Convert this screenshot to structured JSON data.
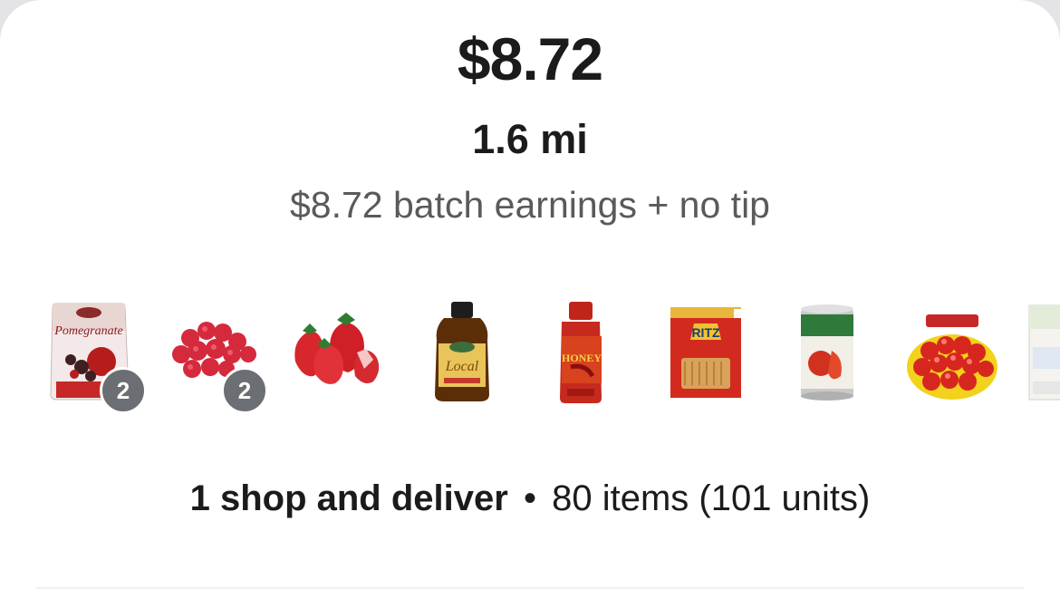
{
  "offer": {
    "price": "$8.72",
    "distance": "1.6 mi",
    "earnings_line": "$8.72 batch earnings + no tip"
  },
  "items": [
    {
      "name": "Dark Chocolate Pomegranate",
      "icon": "pomegranate-chocolate-bag-icon",
      "brand_text": "Pomegranate",
      "quantity": "2"
    },
    {
      "name": "Raspberries",
      "icon": "raspberries-icon",
      "quantity": "2"
    },
    {
      "name": "Strawberries",
      "icon": "strawberries-icon"
    },
    {
      "name": "Local Honey",
      "icon": "honey-bottle-icon",
      "label_text": "Local"
    },
    {
      "name": "Hot Honey",
      "icon": "hot-honey-bottle-icon",
      "label_text": "HONEY"
    },
    {
      "name": "Ritz Fresh Stacks",
      "icon": "ritz-crackers-box-icon",
      "label_text": "RITZ"
    },
    {
      "name": "Canned Tomatoes",
      "icon": "canned-tomatoes-icon"
    },
    {
      "name": "Cherubs Tomatoes",
      "icon": "cherry-tomatoes-icon"
    },
    {
      "name": "Simply Nature",
      "icon": "simply-nature-package-icon"
    }
  ],
  "summary": {
    "type": "1 shop and deliver",
    "separator": "•",
    "counts": "80 items (101 units)"
  },
  "colors": {
    "text_primary": "#1b1b1b",
    "text_secondary": "#5a5a5a",
    "badge": "#6b6e73"
  }
}
